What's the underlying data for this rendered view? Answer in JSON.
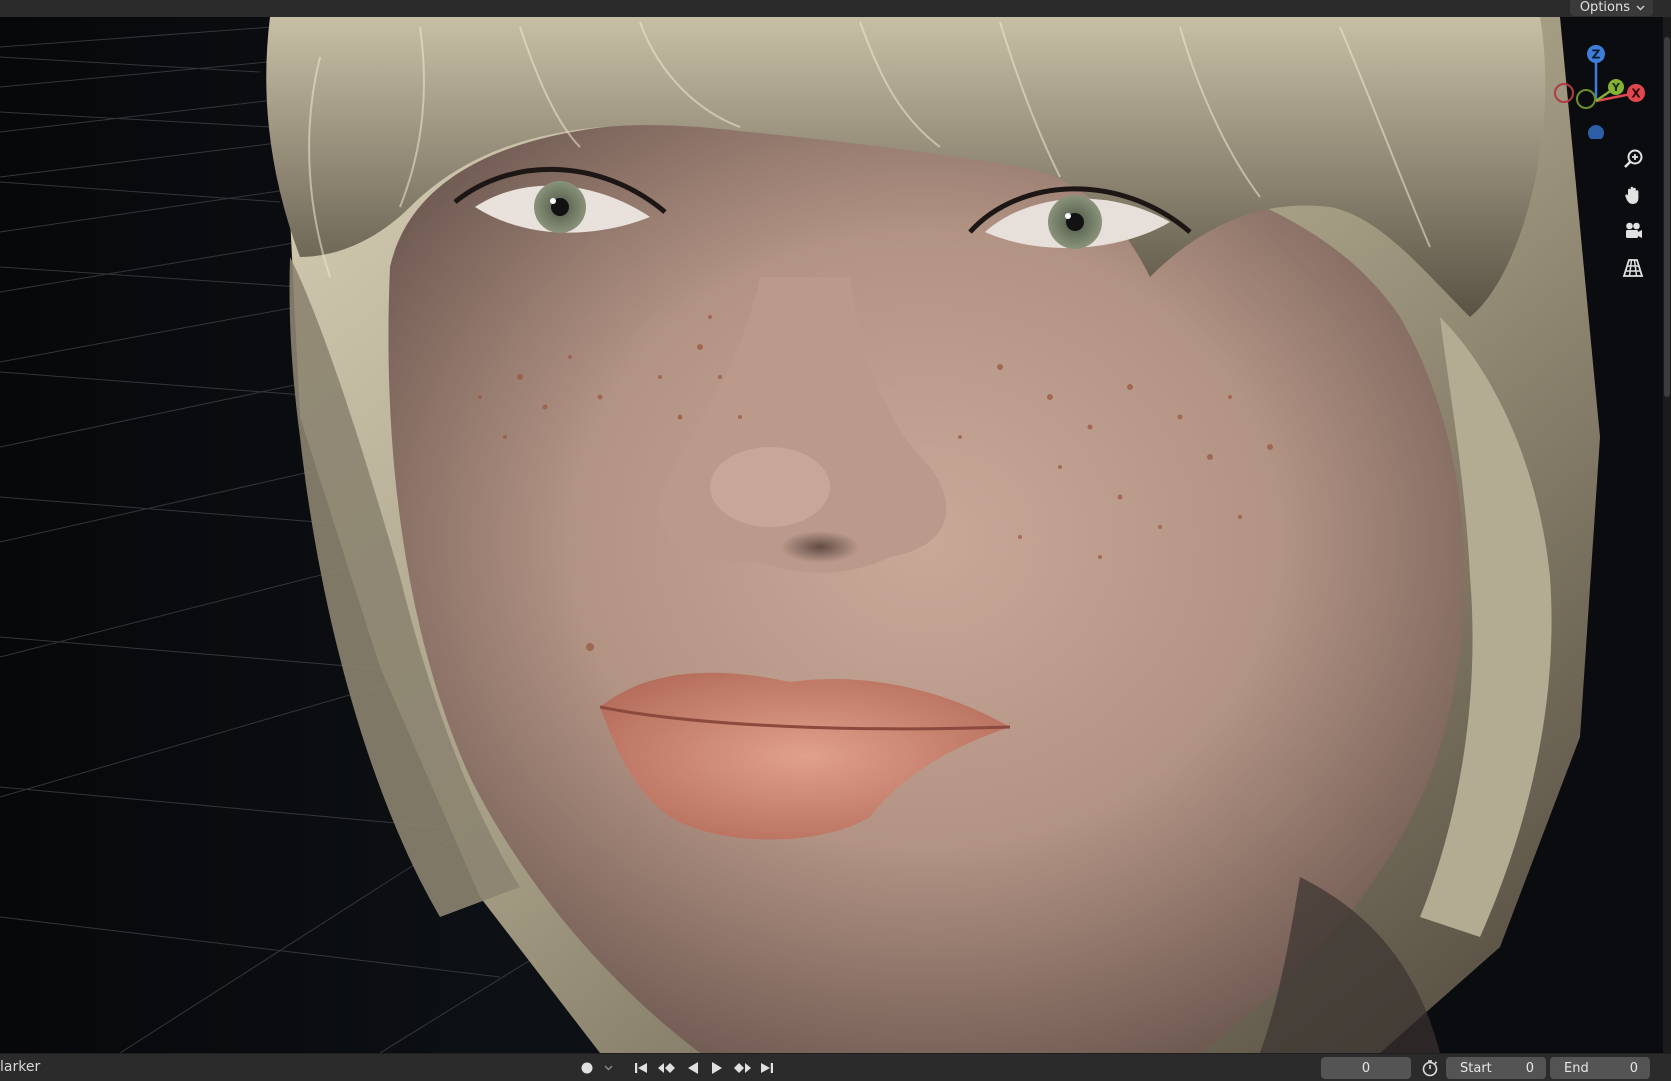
{
  "header": {
    "options_label": "Options"
  },
  "viewport": {
    "subject": "face-render",
    "gizmo_axes": {
      "z": "Z",
      "y": "Y",
      "x": "X"
    },
    "gizmo_colors": {
      "x": "#e0474f",
      "y": "#84b330",
      "z": "#3d7edb"
    },
    "nav_tools": [
      "zoom-icon",
      "hand-pan-icon",
      "camera-icon",
      "perspective-grid-icon"
    ]
  },
  "timeline": {
    "marker_label": "larker",
    "current_frame": "0",
    "start_label": "Start",
    "start_value": "0",
    "end_label": "End",
    "end_value": "0"
  }
}
